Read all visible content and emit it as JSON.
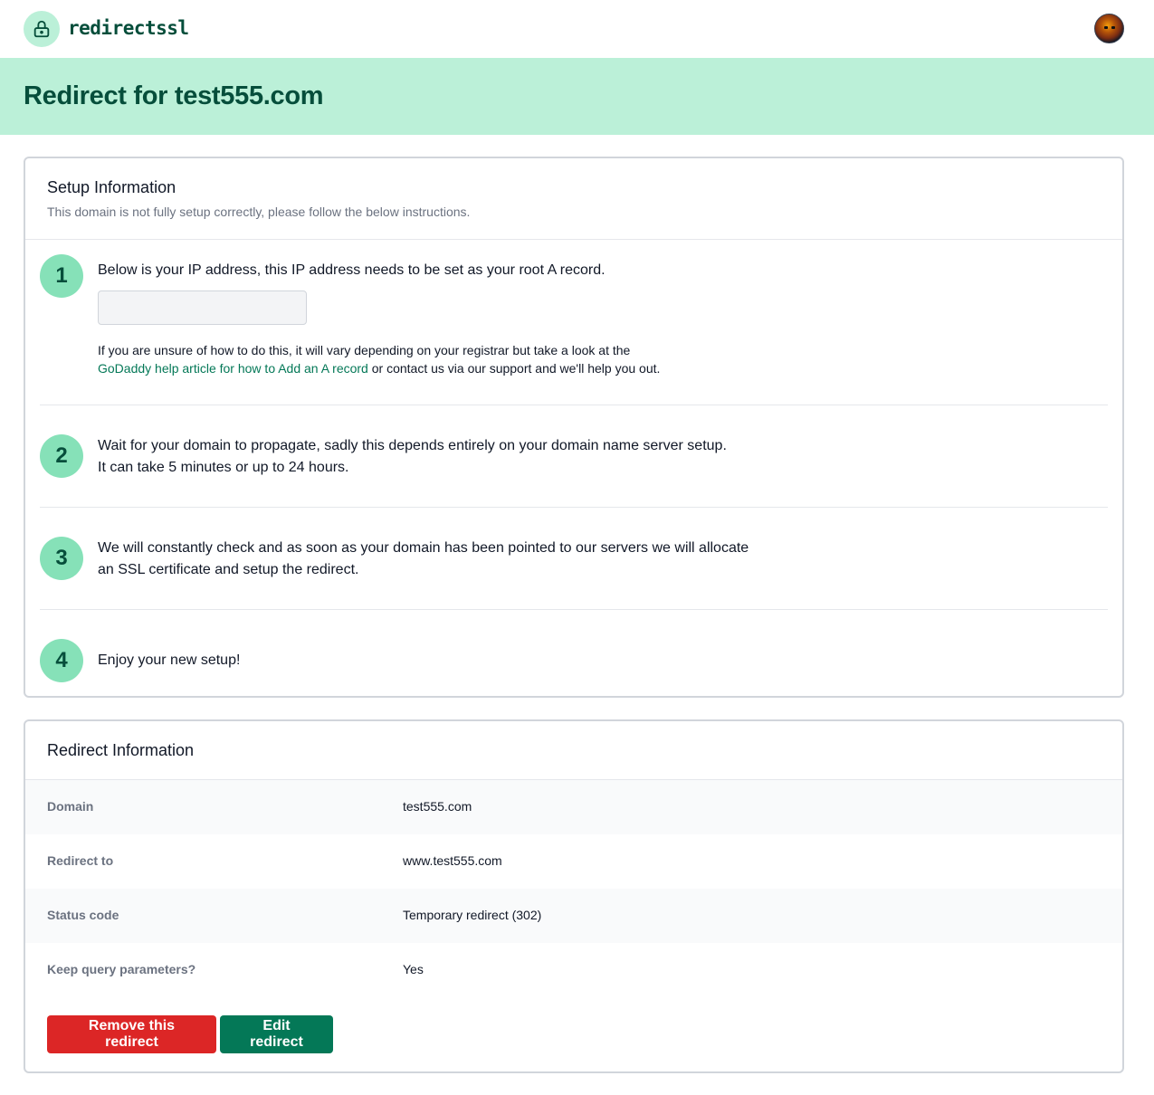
{
  "app": {
    "name": "redirectssl"
  },
  "page": {
    "title": "Redirect for test555.com"
  },
  "setup": {
    "title": "Setup Information",
    "subtitle": "This domain is not fully setup correctly, please follow the below instructions.",
    "steps": [
      {
        "number": "1",
        "text": "Below is your IP address, this IP address needs to be set as your root A record."
      },
      {
        "number": "2",
        "text": "Wait for your domain to propagate, sadly this depends entirely on your domain name server setup. It can take 5 minutes or up to 24 hours."
      },
      {
        "number": "3",
        "text": "We will constantly check and as soon as your domain has been pointed to our servers we will allocate an SSL certificate and setup the redirect."
      },
      {
        "number": "4",
        "text": "Enjoy your new setup!"
      }
    ],
    "ip_value": "",
    "help_before": "If you are unsure of how to do this, it will vary depending on your registrar but take a look at the",
    "help_link": "GoDaddy help article for how to Add an A record",
    "help_after": " or contact us via our support and we'll help you out."
  },
  "redirect": {
    "title": "Redirect Information",
    "rows": [
      {
        "label": "Domain",
        "value": "test555.com"
      },
      {
        "label": "Redirect to",
        "value": "www.test555.com"
      },
      {
        "label": "Status code",
        "value": "Temporary redirect (302)"
      },
      {
        "label": "Keep query parameters?",
        "value": "Yes"
      }
    ],
    "remove_label": "Remove this redirect",
    "edit_label": "Edit redirect"
  },
  "colors": {
    "accent": "#047857",
    "banner": "#bbf0d8",
    "danger": "#dc2626"
  }
}
